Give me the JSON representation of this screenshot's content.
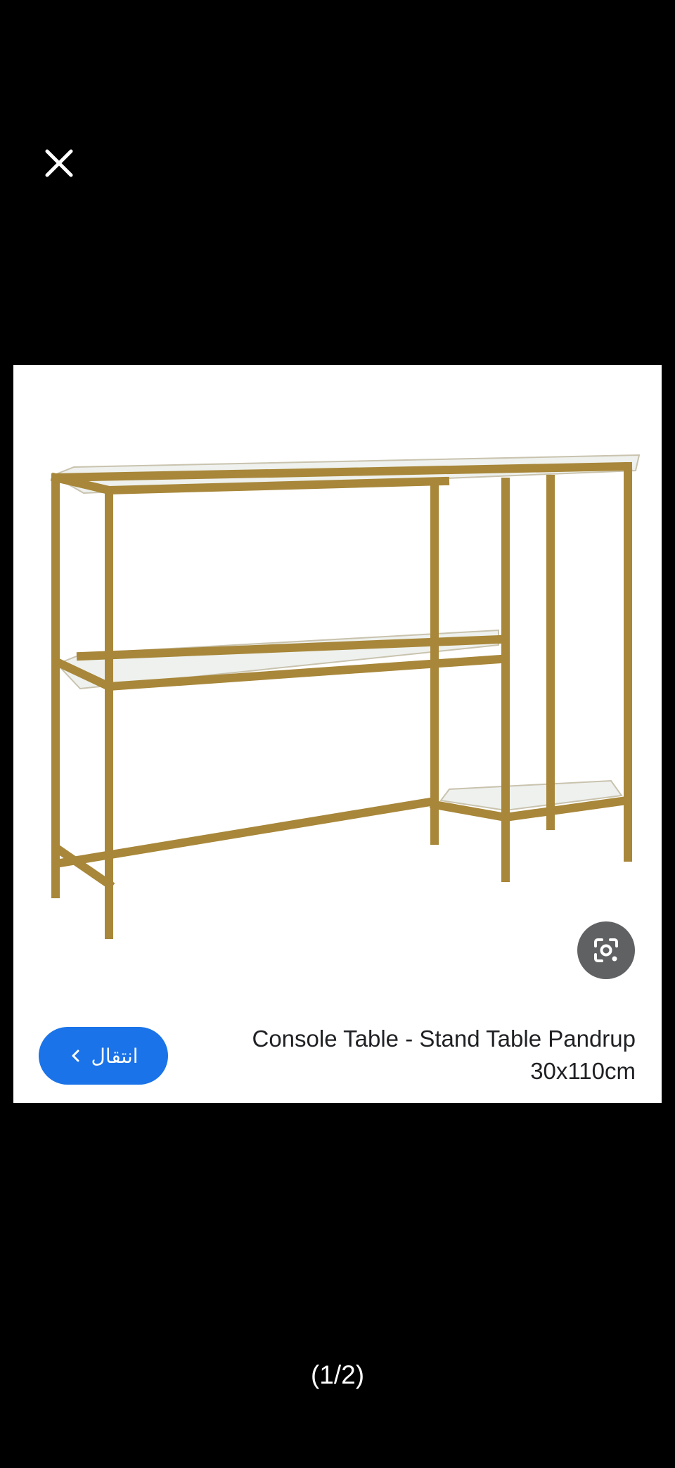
{
  "viewer": {
    "close_label": "close",
    "counter": "(1/2)"
  },
  "result": {
    "title": "Console Table - Stand Table Pandrup 30x110cm",
    "visit_label": "انتقال",
    "lens_label": "Search inside image"
  },
  "icons": {
    "close": "close-icon",
    "lens": "lens-icon",
    "chevron": "chevron-left-icon"
  },
  "colors": {
    "background": "#000000",
    "card": "#ffffff",
    "accent": "#1a73e8",
    "lens_bg": "#5f6163",
    "frame": "#a8873a",
    "title_text": "#202124"
  }
}
